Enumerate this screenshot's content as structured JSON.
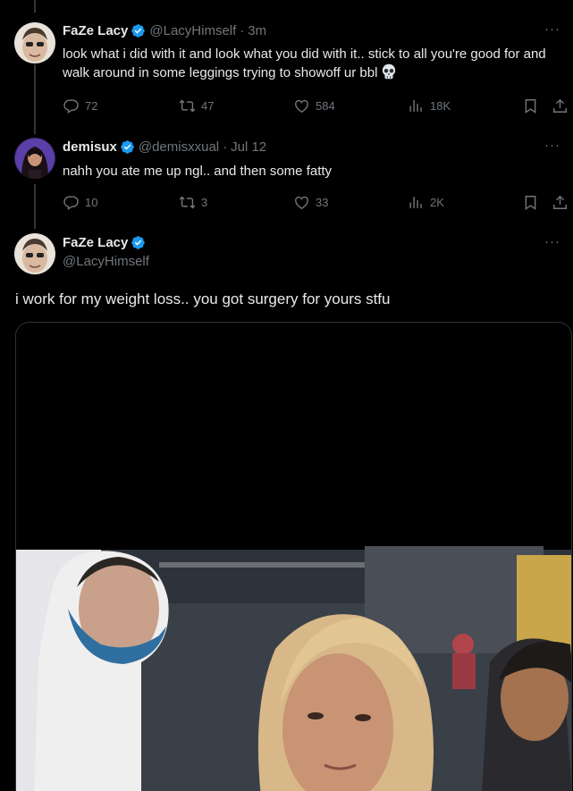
{
  "tweets": [
    {
      "name": "FaZe Lacy",
      "handle": "@LacyHimself",
      "time": "3m",
      "text": "look what i did with it and look what you did with it.. stick to all you're good for and walk around in some leggings trying to showoff ur bbl",
      "emoji": "skull",
      "stats": {
        "replies": "72",
        "reposts": "47",
        "likes": "584",
        "views": "18K"
      }
    },
    {
      "name": "demisux",
      "handle": "@demisxxual",
      "time": "Jul 12",
      "text": "nahh you ate me up ngl.. and then some fatty",
      "stats": {
        "replies": "10",
        "reposts": "3",
        "likes": "33",
        "views": "2K"
      }
    }
  ],
  "main_tweet": {
    "name": "FaZe Lacy",
    "handle": "@LacyHimself",
    "text": "i work for my weight loss.. you got surgery for yours stfu"
  },
  "icons": {
    "verified": "verified-badge-icon",
    "reply": "reply-icon",
    "repost": "repost-icon",
    "like": "heart-icon",
    "views": "views-icon",
    "bookmark": "bookmark-icon",
    "share": "share-icon",
    "more": "more-icon"
  },
  "colors": {
    "background": "#000000",
    "verified": "#1d9bf0",
    "secondary_text": "#71767b",
    "divider": "#2f3336"
  }
}
